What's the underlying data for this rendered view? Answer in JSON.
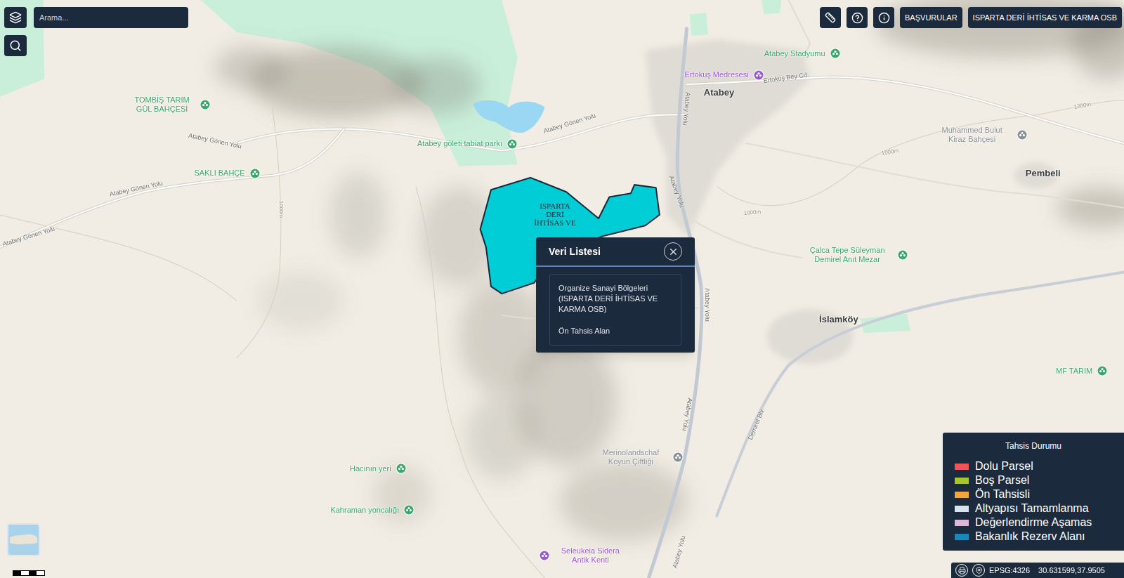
{
  "search": {
    "placeholder": "Arama..."
  },
  "top_buttons": [
    "BAŞVURULAR",
    "ISPARTA DERİ İHTİSAS VE KARMA OSB"
  ],
  "map": {
    "area_label": "ISPARTA DERİ İHTİSAS VE",
    "places": [
      {
        "text": "TOMBİŞ TARIM GÜL BAHÇESİ",
        "kind": "poi",
        "color": "#3aa76d"
      },
      {
        "text": "Atabey göleti tabiat parkı",
        "kind": "poi",
        "color": "#3aa76d"
      },
      {
        "text": "SAKLI BAHÇE",
        "kind": "poi",
        "color": "#3aa76d"
      },
      {
        "text": "Atabey Stadyumu",
        "kind": "poi",
        "color": "#3aa76d"
      },
      {
        "text": "Ertokuş Medresesi",
        "kind": "poi",
        "color": "#9b59d0"
      },
      {
        "text": "Muhammed Bulut Kiraz Bahçesi",
        "kind": "poi",
        "color": "#8a8f96"
      },
      {
        "text": "Çalca Tepe Süleyman Demirel Anıt Mezar",
        "kind": "poi",
        "color": "#3aa76d"
      },
      {
        "text": "MF TARIM",
        "kind": "poi",
        "color": "#3aa76d"
      },
      {
        "text": "Merinolandschaf Koyun Çiftliği",
        "kind": "poi",
        "color": "#8a8f96"
      },
      {
        "text": "Hacının yeri",
        "kind": "poi",
        "color": "#3aa76d"
      },
      {
        "text": "Kahraman yoncalığı",
        "kind": "poi",
        "color": "#3aa76d"
      },
      {
        "text": "Seleukeia Sidera Antik Kenti",
        "kind": "poi",
        "color": "#9b59d0"
      },
      {
        "text": "Atabey",
        "kind": "town"
      },
      {
        "text": "Pembeli",
        "kind": "town"
      },
      {
        "text": "İslamköy",
        "kind": "town"
      },
      {
        "text": "Atabey Gönen Yolu",
        "kind": "road"
      },
      {
        "text": "Atabey Gönen Yolu",
        "kind": "road"
      },
      {
        "text": "Atabey Gönen Yolu",
        "kind": "road"
      },
      {
        "text": "Atabey Gönen Yolu",
        "kind": "road"
      },
      {
        "text": "Atabey Yolu",
        "kind": "road"
      },
      {
        "text": "Atabey Yolu",
        "kind": "road"
      },
      {
        "text": "Atabey Yolu",
        "kind": "road"
      },
      {
        "text": "Atabey Yolu",
        "kind": "road"
      },
      {
        "text": "Atabey Yolu",
        "kind": "road"
      },
      {
        "text": "Ertokuş Bey Cd.",
        "kind": "road"
      },
      {
        "text": "Demirel Blv.",
        "kind": "road"
      },
      {
        "text": "1000m",
        "kind": "contour"
      },
      {
        "text": "1000m",
        "kind": "contour"
      },
      {
        "text": "1000m",
        "kind": "contour"
      },
      {
        "text": "1200m",
        "kind": "contour"
      }
    ]
  },
  "popup": {
    "title": "Veri Listesi",
    "lines": [
      "Organize Sanayi Bölgeleri (ISPARTA DERİ İHTİSAS VE KARMA OSB)",
      "Ön Tahsis Alan"
    ]
  },
  "legend": {
    "title": "Tahsis Durumu",
    "items": [
      {
        "label": "Dolu Parsel",
        "color": "#f0545b"
      },
      {
        "label": "Boş Parsel",
        "color": "#a8c62b"
      },
      {
        "label": "Ön Tahsisli",
        "color": "#f4a43c"
      },
      {
        "label": "Altyapısı Tamamlanma",
        "color": "#d6e4f0"
      },
      {
        "label": "Değerlendirme Aşamas",
        "color": "#d8b7d8"
      },
      {
        "label": "Bakanlık Rezerv Alanı",
        "color": "#1b86b8"
      }
    ]
  },
  "status_bar": {
    "projection": "EPSG:4326",
    "coordinates": "30.631599,37.9505"
  }
}
